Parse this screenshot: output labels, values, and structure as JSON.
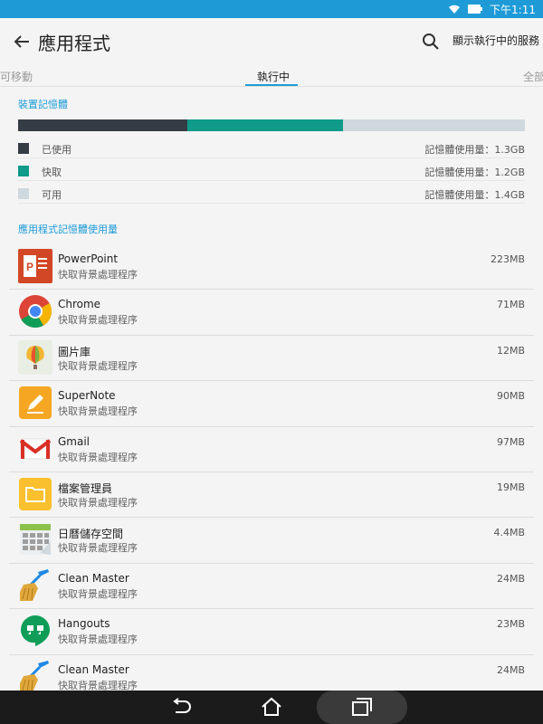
{
  "status": {
    "time": "下午1:11"
  },
  "header": {
    "title": "應用程式",
    "show_services": "顯示執行中的服務"
  },
  "tabs": {
    "left": "可移動",
    "center": "執行中",
    "right": "全部"
  },
  "memory": {
    "section_title": "裝置記憶體",
    "total_gb": 3.9,
    "segments": [
      {
        "label": "已使用",
        "value": "記憶體使用量：1.3GB",
        "gb": 1.3,
        "color": "#363c45"
      },
      {
        "label": "快取",
        "value": "記憶體使用量：1.2GB",
        "gb": 1.2,
        "color": "#0f9a89"
      },
      {
        "label": "可用",
        "value": "記憶體使用量：1.4GB",
        "gb": 1.4,
        "color": "#cfd8dd"
      }
    ]
  },
  "apps": {
    "section_title": "應用程式記憶體使用量",
    "items": [
      {
        "name": "PowerPoint",
        "sub": "快取背景處理程序",
        "size": "223MB",
        "icon": "powerpoint-icon"
      },
      {
        "name": "Chrome",
        "sub": "快取背景處理程序",
        "size": "71MB",
        "icon": "chrome-icon"
      },
      {
        "name": "圖片庫",
        "sub": "快取背景處理程序",
        "size": "12MB",
        "icon": "gallery-icon"
      },
      {
        "name": "SuperNote",
        "sub": "快取背景處理程序",
        "size": "90MB",
        "icon": "supernote-icon"
      },
      {
        "name": "Gmail",
        "sub": "快取背景處理程序",
        "size": "97MB",
        "icon": "gmail-icon"
      },
      {
        "name": "檔案管理員",
        "sub": "快取背景處理程序",
        "size": "19MB",
        "icon": "file-manager-icon"
      },
      {
        "name": "日曆儲存空間",
        "sub": "快取背景處理程序",
        "size": "4.4MB",
        "icon": "calendar-storage-icon"
      },
      {
        "name": "Clean Master",
        "sub": "快取背景處理程序",
        "size": "24MB",
        "icon": "broom-icon"
      },
      {
        "name": "Hangouts",
        "sub": "快取背景處理程序",
        "size": "23MB",
        "icon": "hangouts-icon"
      },
      {
        "name": "Clean Master",
        "sub": "快取背景處理程序",
        "size": "24MB",
        "icon": "broom-icon"
      }
    ]
  }
}
